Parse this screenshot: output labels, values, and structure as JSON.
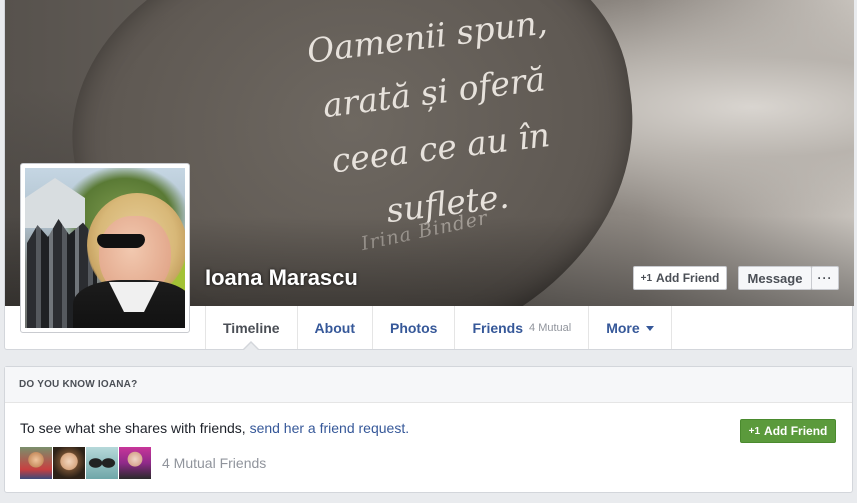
{
  "profile": {
    "name": "Ioana Marascu"
  },
  "cover": {
    "quote_lines": [
      "Oamenii spun,",
      "arată și oferă",
      "ceea ce au în suflete."
    ],
    "signature": "Irina Binder"
  },
  "actions": {
    "add_friend_label": "Add Friend",
    "message_label": "Message",
    "more_label": "···"
  },
  "nav": {
    "tabs": [
      {
        "label": "Timeline",
        "active": true
      },
      {
        "label": "About"
      },
      {
        "label": "Photos"
      },
      {
        "label": "Friends",
        "count": "4 Mutual"
      },
      {
        "label": "More"
      }
    ]
  },
  "know_card": {
    "header": "DO YOU KNOW IOANA?",
    "text": "To see what she shares with friends,",
    "link": "send her a friend request.",
    "add_friend_label": "Add Friend",
    "mutual_friends": "4 Mutual Friends"
  },
  "icons": {
    "add_friend": "+1",
    "more_caret": "chevron-down-icon"
  },
  "colors": {
    "link": "#365899",
    "green_button": "#5b9a3c",
    "background": "#e9ebee"
  }
}
